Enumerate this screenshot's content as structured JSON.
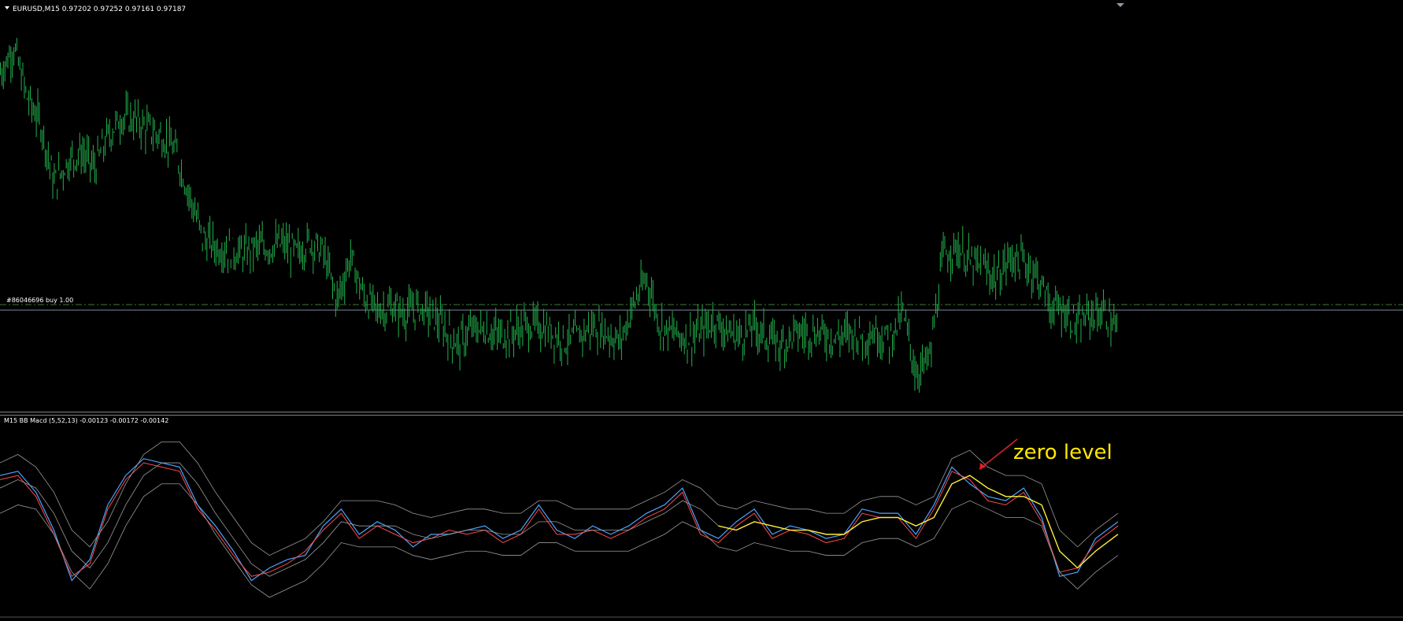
{
  "main_panel": {
    "header_text": "EURUSD,M15  0.97202 0.97252 0.97161 0.97187",
    "order_label": "#86046696 buy 1.00"
  },
  "indicator_panel": {
    "header_text": "M15 BB Macd (5,52,13) -0.00123 -0.00172 -0.00142",
    "annotation_text": "zero level"
  },
  "colors": {
    "background": "#000000",
    "candles": "#22b14c",
    "order_line": "#3a7a3a",
    "hline": "#7a8a9a",
    "panel_border": "#808080",
    "macd_blue": "#4aa3ff",
    "macd_red": "#ff4a4a",
    "macd_yellow": "#ffee33",
    "band_grey": "#9a9a9a",
    "annotation": "#ffe800",
    "arrow": "#e0202a"
  },
  "icons": [
    "dropdown-arrow-icon",
    "shift-marker-icon"
  ],
  "chart_data": [
    {
      "type": "line",
      "description_key": "EURUSD M15 price (rendered as green bar ticks)",
      "title": "EURUSD,M15",
      "x": [
        0,
        15,
        30,
        45,
        60,
        75,
        90,
        105,
        120,
        135,
        150,
        165,
        180,
        195,
        210,
        225,
        240,
        255,
        270,
        285,
        300,
        315,
        330,
        345,
        360,
        375,
        390,
        405,
        420,
        435,
        450,
        465,
        480,
        495,
        510,
        525,
        540,
        555,
        570,
        585,
        600,
        615,
        630,
        645,
        660,
        675,
        690,
        705,
        720,
        735,
        750,
        765,
        780,
        795,
        810,
        825,
        840,
        855,
        870,
        885,
        900,
        915,
        930,
        945,
        960,
        975,
        990,
        1005,
        1020,
        1035,
        1050,
        1065,
        1080,
        1095,
        1110,
        1125,
        1140,
        1155,
        1170,
        1185,
        1200,
        1215,
        1230,
        1245
      ],
      "y": [
        0.996,
        0.9968,
        0.9952,
        0.9944,
        0.9925,
        0.9932,
        0.9935,
        0.993,
        0.994,
        0.9946,
        0.9945,
        0.9942,
        0.994,
        0.9935,
        0.9922,
        0.9908,
        0.9905,
        0.9904,
        0.9903,
        0.9905,
        0.9905,
        0.9906,
        0.9903,
        0.9907,
        0.9903,
        0.9888,
        0.9902,
        0.9889,
        0.9885,
        0.9886,
        0.9884,
        0.9886,
        0.9884,
        0.9879,
        0.9874,
        0.9879,
        0.9879,
        0.9877,
        0.9878,
        0.988,
        0.988,
        0.9878,
        0.9875,
        0.9877,
        0.988,
        0.9878,
        0.9875,
        0.9887,
        0.9895,
        0.988,
        0.9878,
        0.9876,
        0.9878,
        0.9882,
        0.9878,
        0.9877,
        0.988,
        0.9876,
        0.9874,
        0.9878,
        0.9878,
        0.9878,
        0.9876,
        0.9878,
        0.9877,
        0.9878,
        0.9876,
        0.9884,
        0.9865,
        0.987,
        0.9902,
        0.9905,
        0.99,
        0.9898,
        0.9895,
        0.9902,
        0.99,
        0.9896,
        0.9886,
        0.9885,
        0.988,
        0.9884,
        0.9884,
        0.9878
      ]
    },
    {
      "type": "line",
      "title": "M15 BB Macd (5,52,13)",
      "x": [
        0,
        20,
        40,
        60,
        80,
        100,
        120,
        140,
        160,
        180,
        200,
        220,
        240,
        260,
        280,
        300,
        320,
        340,
        360,
        380,
        400,
        420,
        440,
        460,
        480,
        500,
        520,
        540,
        560,
        580,
        600,
        620,
        640,
        660,
        680,
        700,
        720,
        740,
        760,
        780,
        800,
        820,
        840,
        860,
        880,
        900,
        920,
        940,
        960,
        980,
        1000,
        1020,
        1040,
        1060,
        1080,
        1100,
        1120,
        1140,
        1160,
        1180,
        1200,
        1220,
        1245
      ],
      "series": [
        {
          "values": [
            0.001,
            0.0011,
            0.0006,
            -0.0003,
            -0.0015,
            -0.001,
            0.0003,
            0.001,
            0.0014,
            0.0013,
            0.0012,
            0.0003,
            -0.0002,
            -0.0008,
            -0.0015,
            -0.0012,
            -0.001,
            -0.0009,
            -0.0002,
            0.0002,
            -0.0004,
            -0.0001,
            -0.0003,
            -0.0007,
            -0.0004,
            -0.0004,
            -0.0003,
            -0.0002,
            -0.0005,
            -0.0003,
            0.0003,
            -0.0003,
            -0.0005,
            -0.0002,
            -0.0004,
            -0.0002,
            0.0001,
            0.0003,
            0.0007,
            -0.0003,
            -0.0005,
            -0.0001,
            0.0002,
            -0.0004,
            -0.0002,
            -0.0003,
            -0.0005,
            -0.0004,
            0.0002,
            0.0001,
            0.0001,
            -0.0004,
            0.0003,
            0.0012,
            0.0008,
            0.0005,
            0.0004,
            0.0007,
            0.0,
            -0.0014,
            -0.0013,
            -0.0005,
            -0.0001
          ]
        },
        {
          "values": [
            0.0009,
            0.001,
            0.0005,
            -0.0004,
            -0.0014,
            -0.0011,
            0.0002,
            0.0009,
            0.0013,
            0.0012,
            0.0011,
            0.0002,
            -0.0003,
            -0.0009,
            -0.0014,
            -0.0013,
            -0.0011,
            -0.0008,
            -0.0003,
            0.0001,
            -0.0005,
            -0.0002,
            -0.0004,
            -0.0006,
            -0.0005,
            -0.0003,
            -0.0004,
            -0.0003,
            -0.0006,
            -0.0004,
            0.0002,
            -0.0004,
            -0.0004,
            -0.0003,
            -0.0005,
            -0.0003,
            0.0,
            0.0002,
            0.0006,
            -0.0004,
            -0.0006,
            -0.0002,
            0.0001,
            -0.0005,
            -0.0003,
            -0.0004,
            -0.0006,
            -0.0005,
            0.0001,
            0.0,
            0.0,
            -0.0005,
            0.0002,
            0.0011,
            0.0009,
            0.0004,
            0.0003,
            0.0006,
            -0.0001,
            -0.0013,
            -0.0012,
            -0.0006,
            -0.0002
          ]
        },
        {
          "values": [
            0.0007,
            0.0009,
            0.0007,
            0.0001,
            -0.0008,
            -0.0012,
            -0.0006,
            0.0003,
            0.001,
            0.0013,
            0.0013,
            0.0008,
            0.0001,
            -0.0005,
            -0.0011,
            -0.0014,
            -0.0012,
            -0.001,
            -0.0006,
            -0.0001,
            -0.0002,
            -0.0002,
            -0.0002,
            -0.0004,
            -0.0005,
            -0.0004,
            -0.0003,
            -0.0003,
            -0.0004,
            -0.0004,
            -0.0001,
            -0.0001,
            -0.0003,
            -0.0003,
            -0.0003,
            -0.0003,
            -0.0001,
            0.0001,
            0.0004,
            0.0002,
            -0.0002,
            -0.0003,
            -0.0001,
            -0.0002,
            -0.0003,
            -0.0003,
            -0.0004,
            -0.0004,
            -0.0001,
            0.0,
            0.0,
            -0.0002,
            0.0,
            0.0008,
            0.001,
            0.0007,
            0.0005,
            0.0005,
            0.0003,
            -0.0008,
            -0.0012,
            -0.0008,
            -0.0004
          ]
        },
        {
          "values": [
            0.0013,
            0.0015,
            0.0012,
            0.0006,
            -0.0003,
            -0.0007,
            -0.0001,
            0.0008,
            0.0015,
            0.0018,
            0.0018,
            0.0013,
            0.0006,
            0.0,
            -0.0006,
            -0.0009,
            -0.0007,
            -0.0005,
            -0.0001,
            0.0004,
            0.0004,
            0.0004,
            0.0003,
            0.0001,
            0.0,
            0.0001,
            0.0002,
            0.0002,
            0.0001,
            0.0001,
            0.0004,
            0.0004,
            0.0002,
            0.0002,
            0.0002,
            0.0002,
            0.0004,
            0.0006,
            0.0009,
            0.0007,
            0.0003,
            0.0002,
            0.0004,
            0.0003,
            0.0002,
            0.0002,
            0.0001,
            0.0001,
            0.0004,
            0.0005,
            0.0005,
            0.0003,
            0.0005,
            0.0014,
            0.0016,
            0.0012,
            0.001,
            0.001,
            0.0008,
            -0.0003,
            -0.0007,
            -0.0003,
            0.0001
          ]
        },
        {
          "values": [
            0.0001,
            0.0003,
            0.0002,
            -0.0004,
            -0.0013,
            -0.0017,
            -0.0011,
            -0.0002,
            0.0005,
            0.0008,
            0.0008,
            0.0003,
            -0.0004,
            -0.001,
            -0.0016,
            -0.0019,
            -0.0017,
            -0.0015,
            -0.0011,
            -0.0006,
            -0.0007,
            -0.0007,
            -0.0007,
            -0.0009,
            -0.001,
            -0.0009,
            -0.0008,
            -0.0008,
            -0.0009,
            -0.0009,
            -0.0006,
            -0.0006,
            -0.0008,
            -0.0008,
            -0.0008,
            -0.0008,
            -0.0006,
            -0.0004,
            -0.0001,
            -0.0003,
            -0.0007,
            -0.0008,
            -0.0006,
            -0.0007,
            -0.0008,
            -0.0008,
            -0.0009,
            -0.0009,
            -0.0006,
            -0.0005,
            -0.0005,
            -0.0007,
            -0.0005,
            0.0002,
            0.0004,
            0.0002,
            0.0,
            0.0,
            -0.0002,
            -0.0013,
            -0.0017,
            -0.0013,
            -0.0009
          ]
        }
      ],
      "highlight_yellow_range_x": [
        800,
        1245
      ]
    }
  ]
}
